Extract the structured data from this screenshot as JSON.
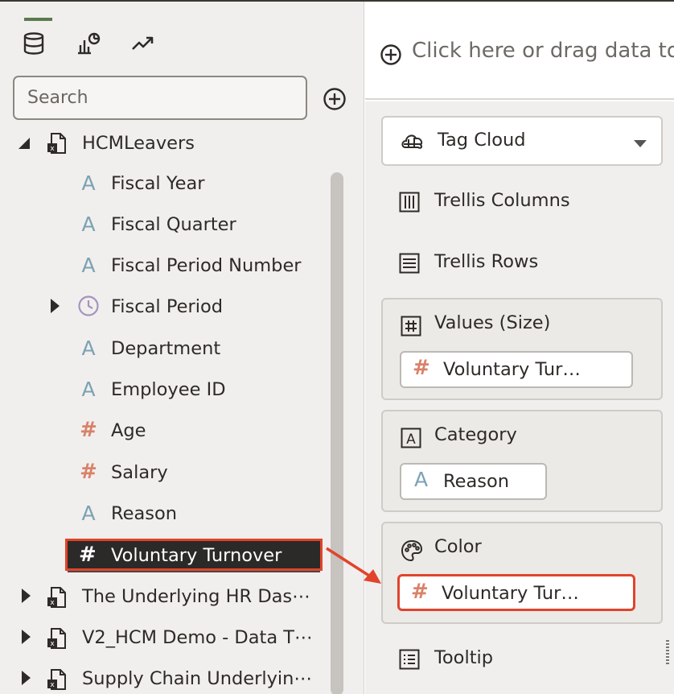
{
  "left_panel": {
    "tabs": [
      {
        "icon": "database-icon",
        "active": true
      },
      {
        "icon": "chart-icon",
        "active": false
      },
      {
        "icon": "trend-icon",
        "active": false
      }
    ],
    "search": {
      "placeholder": "Search"
    },
    "dataset": {
      "name": "HCMLeavers",
      "items": [
        {
          "type": "text",
          "label": "Fiscal Year"
        },
        {
          "type": "text",
          "label": "Fiscal Quarter"
        },
        {
          "type": "text",
          "label": "Fiscal Period Number"
        },
        {
          "type": "time",
          "label": "Fiscal Period"
        },
        {
          "type": "text",
          "label": "Department"
        },
        {
          "type": "text",
          "label": "Employee ID"
        },
        {
          "type": "number",
          "label": "Age"
        },
        {
          "type": "number",
          "label": "Salary"
        },
        {
          "type": "text",
          "label": "Reason"
        },
        {
          "type": "number",
          "label": "Voluntary Turnover"
        }
      ]
    },
    "other_datasets": [
      {
        "label": "The Underlying HR Das⋯"
      },
      {
        "label": "V2_HCM Demo - Data T⋯"
      },
      {
        "label": "Supply Chain Underlyin⋯"
      }
    ]
  },
  "right_panel": {
    "drop_hint": "Click here or drag data to",
    "viz_type": "Tag Cloud",
    "trellis_columns": "Trellis Columns",
    "trellis_rows": "Trellis Rows",
    "values": {
      "label": "Values (Size)",
      "item": "Voluntary Tur…"
    },
    "category": {
      "label": "Category",
      "item": "Reason"
    },
    "color": {
      "label": "Color",
      "item": "Voluntary Tur…"
    },
    "tooltip": "Tooltip"
  },
  "colors": {
    "highlight": "#e1442b",
    "measure": "#d8826a",
    "attribute": "#7ba2b4",
    "time": "#a593c0",
    "accent": "#5a7a4e"
  }
}
